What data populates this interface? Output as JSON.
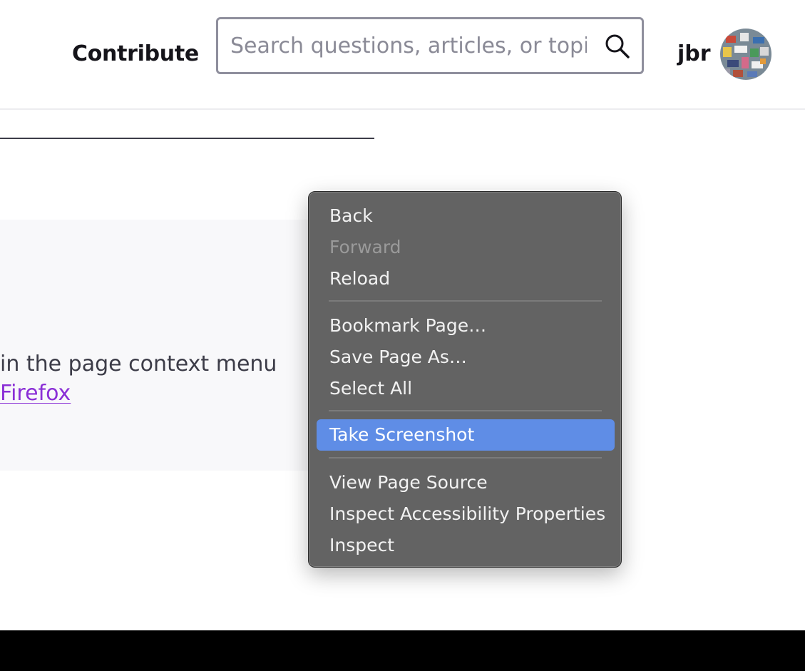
{
  "header": {
    "nav_contribute": "Contribute",
    "search": {
      "placeholder": "Search questions, articles, or topics"
    },
    "user": {
      "name": "jbr"
    }
  },
  "content": {
    "panel_text": "in the page context menu",
    "panel_link": " Firefox"
  },
  "context_menu": {
    "items": [
      {
        "label": "Back",
        "enabled": true
      },
      {
        "label": "Forward",
        "enabled": false
      },
      {
        "label": "Reload",
        "enabled": true
      },
      {
        "label": "Bookmark Page…",
        "enabled": true
      },
      {
        "label": "Save Page As…",
        "enabled": true
      },
      {
        "label": "Select All",
        "enabled": true
      },
      {
        "label": "Take Screenshot",
        "enabled": true,
        "highlighted": true
      },
      {
        "label": "View Page Source",
        "enabled": true
      },
      {
        "label": "Inspect Accessibility Properties",
        "enabled": true
      },
      {
        "label": "Inspect",
        "enabled": true
      }
    ]
  },
  "colors": {
    "menu_background": "#636363",
    "menu_highlight": "#5f8de6",
    "link": "#8a2fd6",
    "search_border": "#8f8f9d"
  }
}
